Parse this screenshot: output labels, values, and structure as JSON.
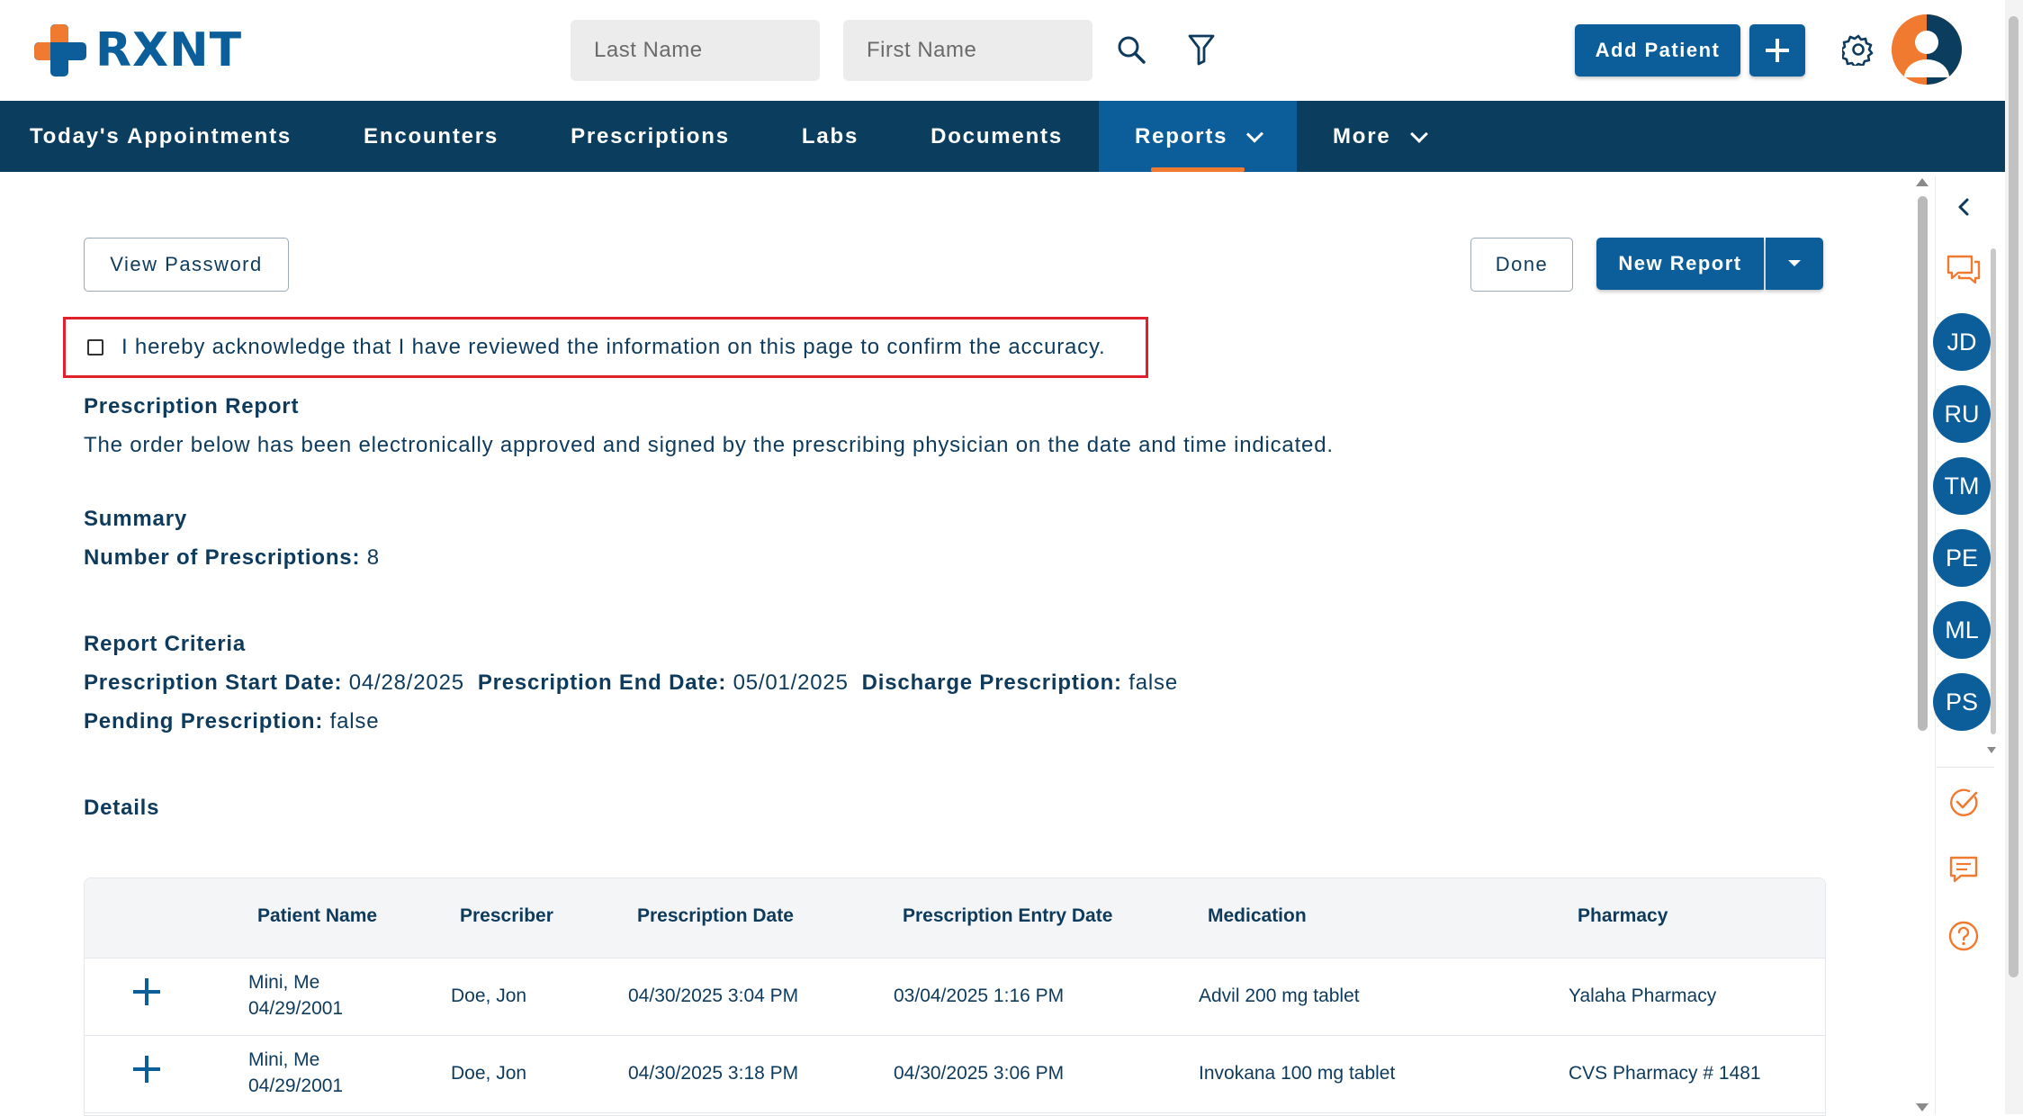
{
  "brand": {
    "name": "RXNT",
    "primary": "#0b5e9a",
    "accent": "#f07a30",
    "nav_bg": "#0b3d5f"
  },
  "header": {
    "last_name_placeholder": "Last Name",
    "first_name_placeholder": "First Name",
    "add_patient_label": "Add Patient",
    "icons": [
      "search-icon",
      "filter-icon",
      "plus-icon",
      "gear-icon",
      "user-avatar-icon"
    ]
  },
  "nav": {
    "items": [
      {
        "label": "Today's Appointments"
      },
      {
        "label": "Encounters"
      },
      {
        "label": "Prescriptions"
      },
      {
        "label": "Labs"
      },
      {
        "label": "Documents"
      },
      {
        "label": "Reports",
        "active": true,
        "has_dropdown": true
      },
      {
        "label": "More",
        "has_dropdown": true
      }
    ]
  },
  "toolbar": {
    "view_password_label": "View Password",
    "done_label": "Done",
    "new_report_label": "New Report"
  },
  "acknowledgement": {
    "text": "I hereby acknowledge that I have reviewed the information on this page to confirm the accuracy.",
    "checked": false
  },
  "report": {
    "title": "Prescription Report",
    "description": "The order below has been electronically approved and signed by the prescribing physician on the date and time indicated.",
    "summary_heading": "Summary",
    "num_prescriptions_label": "Number of Prescriptions:",
    "num_prescriptions_value": "8",
    "criteria_heading": "Report Criteria",
    "start_date_label": "Prescription Start Date:",
    "start_date_value": "04/28/2025",
    "end_date_label": "Prescription End Date:",
    "end_date_value": "05/01/2025",
    "discharge_label": "Discharge Prescription:",
    "discharge_value": "false",
    "pending_label": "Pending Prescription:",
    "pending_value": "false",
    "details_heading": "Details"
  },
  "table": {
    "columns": [
      "Patient Name",
      "Prescriber",
      "Prescription Date",
      "Prescription Entry Date",
      "Medication",
      "Pharmacy"
    ],
    "rows": [
      {
        "patient_name": "Mini, Me",
        "patient_dob": "04/29/2001",
        "prescriber": "Doe, Jon",
        "prescription_date": "04/30/2025 3:04 PM",
        "entry_date": "03/04/2025 1:16 PM",
        "medication": "Advil 200 mg tablet",
        "pharmacy": "Yalaha Pharmacy"
      },
      {
        "patient_name": "Mini, Me",
        "patient_dob": "04/29/2001",
        "prescriber": "Doe, Jon",
        "prescription_date": "04/30/2025 3:18 PM",
        "entry_date": "04/30/2025 3:06 PM",
        "medication": "Invokana 100 mg tablet",
        "pharmacy": "CVS Pharmacy # 1481"
      }
    ]
  },
  "sidebar": {
    "users": [
      "JD",
      "RU",
      "TM",
      "PE",
      "ML",
      "PS"
    ],
    "icons": [
      "chevron-left-icon",
      "chat-bubbles-icon",
      "check-circle-icon",
      "message-icon",
      "help-icon"
    ]
  }
}
